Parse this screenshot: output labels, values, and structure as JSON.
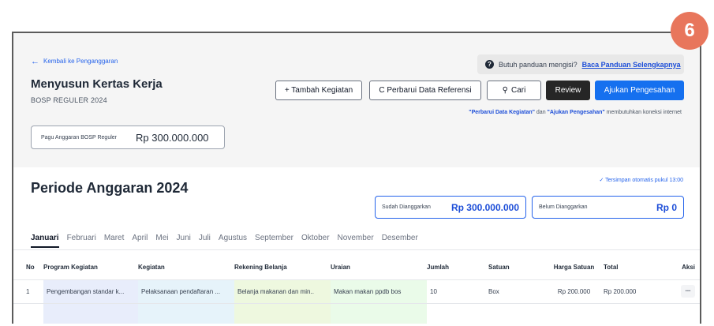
{
  "badge": "6",
  "header": {
    "back_label": "Kembali ke Penganggaran",
    "title": "Menyusun Kertas Kerja",
    "subtitle": "BOSP REGULER 2024",
    "help_text": "Butuh panduan mengisi?",
    "help_link": "Baca Panduan Selengkapnya"
  },
  "toolbar": {
    "add_label": "+ Tambah Kegiatan",
    "refresh_label": "C Perbarui Data Referensi",
    "search_label": "Cari",
    "review_label": "Review",
    "submit_label": "Ajukan Pengesahan"
  },
  "note": {
    "part1": "\"Perbarui Data Kegiatan\"",
    "part2": " dan ",
    "part3": "\"Ajukan Pengesahan\"",
    "part4": " membutuhkan koneksi internet"
  },
  "pagu": {
    "label": "Pagu Anggaran BOSP Reguler",
    "value": "Rp 300.000.000"
  },
  "period": {
    "title": "Periode Anggaran 2024",
    "autosave": "Tersimpan otomatis pukul 13:00",
    "budgeted_label": "Sudah Dianggarkan",
    "budgeted_value": "Rp 300.000.000",
    "unbudgeted_label": "Belum Dianggarkan",
    "unbudgeted_value": "Rp 0"
  },
  "months": [
    "Januari",
    "Februari",
    "Maret",
    "April",
    "Mei",
    "Juni",
    "Juli",
    "Agustus",
    "September",
    "Oktober",
    "November",
    "Desember"
  ],
  "table": {
    "headers": [
      "No",
      "Program Kegiatan",
      "Kegiatan",
      "Rekening Belanja",
      "Uraian",
      "Jumlah",
      "Satuan",
      "Harga Satuan",
      "Total",
      "Aksi"
    ],
    "rows": [
      [
        "1",
        "Pengembangan standar k...",
        "Pelaksanaan pendaftaran ...",
        "Belanja makanan dan min..",
        "Makan makan ppdb bos",
        "10",
        "Box",
        "Rp 200.000",
        "Rp 200.000",
        "..."
      ]
    ]
  }
}
